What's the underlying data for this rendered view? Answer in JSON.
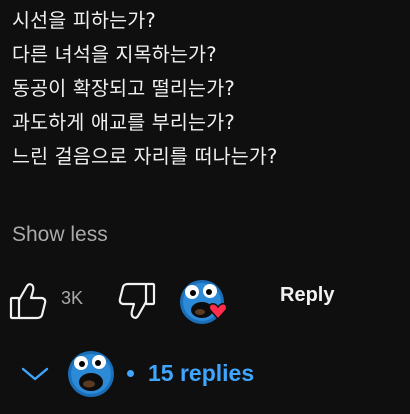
{
  "comment": {
    "lines": [
      "시선을 피하는가?",
      "다른 녀석을 지목하는가?",
      "동공이 확장되고 떨리는가?",
      "과도하게 애교를 부리는가?",
      "느린 걸음으로 자리를 떠나는가?"
    ],
    "show_less_label": "Show less"
  },
  "actions": {
    "like_count": "3K",
    "reply_label": "Reply",
    "like_icon": "thumbs-up-icon",
    "dislike_icon": "thumbs-down-icon"
  },
  "replies": {
    "label": "15 replies",
    "accent": "#3ea6ff"
  }
}
